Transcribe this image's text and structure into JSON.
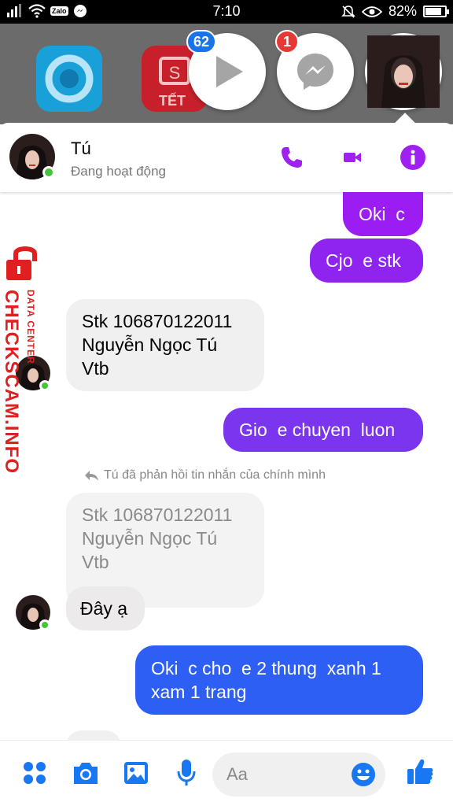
{
  "status_bar": {
    "time": "7:10",
    "battery": "82%",
    "battery_level": 0.82,
    "left_icons": [
      "signal-icon",
      "wifi-icon",
      "zalo-icon",
      "messenger-icon"
    ],
    "zalo_label": "Zalo",
    "right_icons": [
      "mute-icon",
      "eye-icon",
      "battery-icon"
    ]
  },
  "chat_heads": [
    {
      "name": "video-app-head",
      "badge": "62",
      "badge_color": "#1a73e8"
    },
    {
      "name": "messenger-head",
      "badge": "1",
      "badge_color": "#e53935"
    },
    {
      "name": "contact-head",
      "badge": ""
    }
  ],
  "background_apps": [
    {
      "name": "blue-app-icon",
      "color": "#1aa0d8"
    },
    {
      "name": "shopee-tet-app-icon",
      "label": "TẾT",
      "color": "#c8202a"
    }
  ],
  "header": {
    "name": "Tú",
    "status": "Đang hoạt động",
    "accent": "#a020f0"
  },
  "messages": [
    {
      "side": "out",
      "text": "Oki  c",
      "color": "#9c1df2"
    },
    {
      "side": "out",
      "text": "Cjo  e stk",
      "color": "#8f24f0"
    },
    {
      "side": "in",
      "text": "Stk 106870122011\nNguyễn Ngọc Tú\nVtb"
    },
    {
      "side": "out",
      "text": "Gio  e chuyen  luon",
      "color": "#7b35ee"
    },
    {
      "side": "in",
      "text": "Stk 106870122011\nNguyễn Ngọc Tú\nVtb",
      "quoted": true
    },
    {
      "side": "in",
      "text": "Đây ạ"
    },
    {
      "side": "out",
      "text": "Oki  c cho  e 2 thung  xanh 1\nxam 1 trang",
      "color": "#2e5ff5"
    }
  ],
  "reply_note": "Tú đã phản hồi tin nhắn của chính mình",
  "watermark": {
    "main": "CHECKSCAM.INFO",
    "sub": "DATA CENTER"
  },
  "composer": {
    "placeholder": "Aa",
    "accent": "#1877f2"
  }
}
